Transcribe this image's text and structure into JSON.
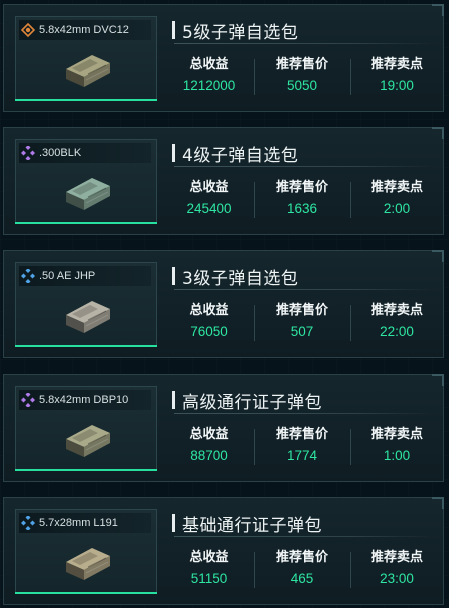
{
  "cards": [
    {
      "item_name": "5.8x42mm DVC12",
      "rarity_icon": "orange-target-icon",
      "rarity_color": "#e0863a",
      "ammo_color": "#a7a582",
      "title": "5级子弹自选包",
      "stats": [
        {
          "label": "总收益",
          "value": "1212000"
        },
        {
          "label": "推荐售价",
          "value": "5050"
        },
        {
          "label": "推荐卖点",
          "value": "19:00"
        }
      ]
    },
    {
      "item_name": ".300BLK",
      "rarity_icon": "purple-diamond-icon",
      "rarity_color": "#b07be8",
      "ammo_color": "#8fb0a0",
      "title": "4级子弹自选包",
      "stats": [
        {
          "label": "总收益",
          "value": "245400"
        },
        {
          "label": "推荐售价",
          "value": "1636"
        },
        {
          "label": "推荐卖点",
          "value": "2:00"
        }
      ]
    },
    {
      "item_name": ".50 AE JHP",
      "rarity_icon": "blue-diamond-icon",
      "rarity_color": "#4fa3e6",
      "ammo_color": "#b7b3a6",
      "title": "3级子弹自选包",
      "stats": [
        {
          "label": "总收益",
          "value": "76050"
        },
        {
          "label": "推荐售价",
          "value": "507"
        },
        {
          "label": "推荐卖点",
          "value": "22:00"
        }
      ]
    },
    {
      "item_name": "5.8x42mm DBP10",
      "rarity_icon": "purple-diamond-icon",
      "rarity_color": "#b07be8",
      "ammo_color": "#a9aa8a",
      "title": "高级通行证子弹包",
      "stats": [
        {
          "label": "总收益",
          "value": "88700"
        },
        {
          "label": "推荐售价",
          "value": "1774"
        },
        {
          "label": "推荐卖点",
          "value": "1:00"
        }
      ]
    },
    {
      "item_name": "5.7x28mm L191",
      "rarity_icon": "blue-diamond-icon",
      "rarity_color": "#4fa3e6",
      "ammo_color": "#b8ad8c",
      "title": "基础通行证子弹包",
      "stats": [
        {
          "label": "总收益",
          "value": "51150"
        },
        {
          "label": "推荐售价",
          "value": "465"
        },
        {
          "label": "推荐卖点",
          "value": "23:00"
        }
      ]
    }
  ]
}
